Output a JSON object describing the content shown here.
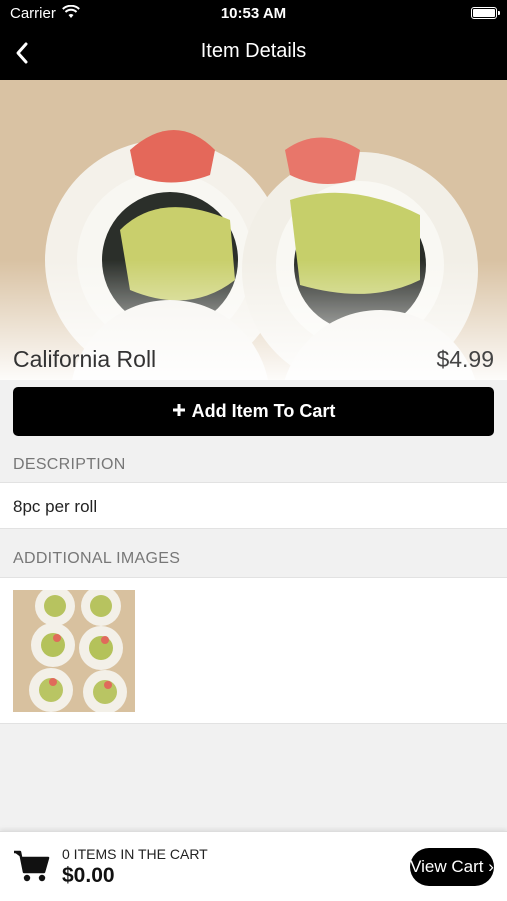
{
  "status_bar": {
    "carrier": "Carrier",
    "time": "10:53 AM"
  },
  "nav": {
    "title": "Item Details",
    "back_icon": "chevron-left-icon"
  },
  "item": {
    "name": "California Roll",
    "price": "$4.99",
    "add_to_cart_label": "Add Item To Cart",
    "add_icon": "plus-icon"
  },
  "description": {
    "header": "DESCRIPTION",
    "text": "8pc per roll"
  },
  "additional_images": {
    "header": "ADDITIONAL IMAGES",
    "count": 1
  },
  "cart": {
    "icon": "cart-icon",
    "count_label": "0 ITEMS IN THE CART",
    "total": "$0.00",
    "view_cart_label": "View Cart ›"
  },
  "colors": {
    "nav_bg": "#000000",
    "button_bg": "#000000",
    "page_bg": "#f1f1f1",
    "section_header": "#777777"
  }
}
